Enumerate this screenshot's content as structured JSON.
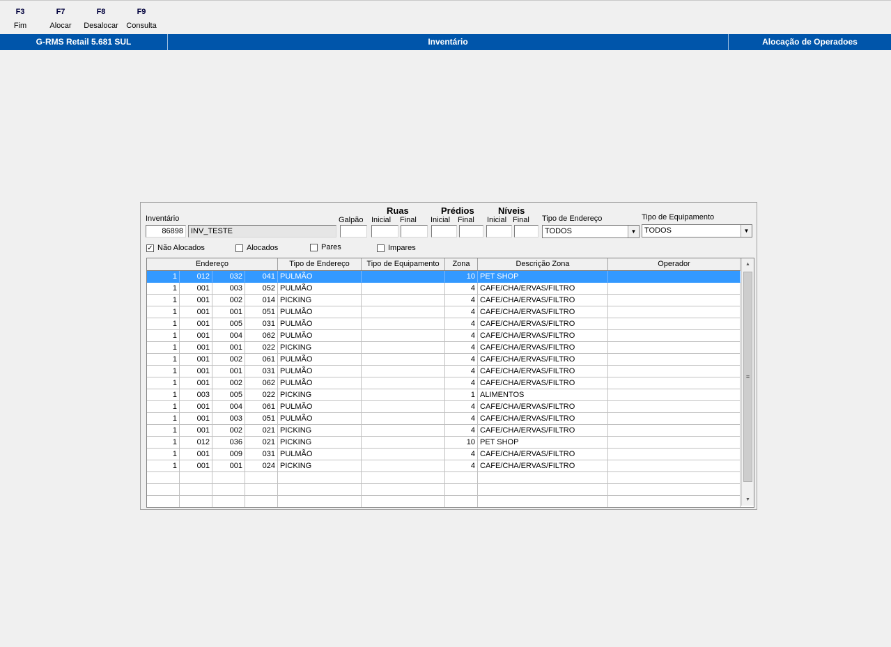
{
  "fkeys": [
    {
      "key": "F3",
      "label": "Fim"
    },
    {
      "key": "F7",
      "label": "Alocar"
    },
    {
      "key": "F8",
      "label": "Desalocar"
    },
    {
      "key": "F9",
      "label": "Consulta"
    }
  ],
  "titlebar": {
    "app": "G-RMS Retail 5.681 SUL",
    "module": "Inventário",
    "screen": "Alocação de Operadoes"
  },
  "filters": {
    "inventario_label": "Inventário",
    "inventario_code": "86898",
    "inventario_name": "INV_TESTE",
    "galpao_label": "Galpão",
    "ruas_label": "Ruas",
    "predios_label": "Prédios",
    "niveis_label": "Níveis",
    "inicial_label": "Inicial",
    "final_label": "Final",
    "tipo_endereco_label": "Tipo de Endereço",
    "tipo_endereco_value": "TODOS",
    "tipo_equipamento_label": "Tipo de Equipamento",
    "tipo_equipamento_value": "TODOS",
    "nao_alocados_label": "Não Alocados",
    "nao_alocados_checked": true,
    "alocados_label": "Alocados",
    "alocados_checked": false,
    "pares_label": "Pares",
    "pares_checked": false,
    "impares_label": "Impares",
    "impares_checked": false
  },
  "grid": {
    "columns": [
      "Endereço",
      "Tipo de Endereço",
      "Tipo de Equipamento",
      "Zona",
      "Descrição Zona",
      "Operador"
    ],
    "rows": [
      [
        "1",
        "012",
        "032",
        "041",
        "PULMÃO",
        "",
        "10",
        "PET SHOP",
        ""
      ],
      [
        "1",
        "001",
        "003",
        "052",
        "PULMÃO",
        "",
        "4",
        "CAFE/CHA/ERVAS/FILTRO",
        ""
      ],
      [
        "1",
        "001",
        "002",
        "014",
        "PICKING",
        "",
        "4",
        "CAFE/CHA/ERVAS/FILTRO",
        ""
      ],
      [
        "1",
        "001",
        "001",
        "051",
        "PULMÃO",
        "",
        "4",
        "CAFE/CHA/ERVAS/FILTRO",
        ""
      ],
      [
        "1",
        "001",
        "005",
        "031",
        "PULMÃO",
        "",
        "4",
        "CAFE/CHA/ERVAS/FILTRO",
        ""
      ],
      [
        "1",
        "001",
        "004",
        "062",
        "PULMÃO",
        "",
        "4",
        "CAFE/CHA/ERVAS/FILTRO",
        ""
      ],
      [
        "1",
        "001",
        "001",
        "022",
        "PICKING",
        "",
        "4",
        "CAFE/CHA/ERVAS/FILTRO",
        ""
      ],
      [
        "1",
        "001",
        "002",
        "061",
        "PULMÃO",
        "",
        "4",
        "CAFE/CHA/ERVAS/FILTRO",
        ""
      ],
      [
        "1",
        "001",
        "001",
        "031",
        "PULMÃO",
        "",
        "4",
        "CAFE/CHA/ERVAS/FILTRO",
        ""
      ],
      [
        "1",
        "001",
        "002",
        "062",
        "PULMÃO",
        "",
        "4",
        "CAFE/CHA/ERVAS/FILTRO",
        ""
      ],
      [
        "1",
        "003",
        "005",
        "022",
        "PICKING",
        "",
        "1",
        "ALIMENTOS",
        ""
      ],
      [
        "1",
        "001",
        "004",
        "061",
        "PULMÃO",
        "",
        "4",
        "CAFE/CHA/ERVAS/FILTRO",
        ""
      ],
      [
        "1",
        "001",
        "003",
        "051",
        "PULMÃO",
        "",
        "4",
        "CAFE/CHA/ERVAS/FILTRO",
        ""
      ],
      [
        "1",
        "001",
        "002",
        "021",
        "PICKING",
        "",
        "4",
        "CAFE/CHA/ERVAS/FILTRO",
        ""
      ],
      [
        "1",
        "012",
        "036",
        "021",
        "PICKING",
        "",
        "10",
        "PET SHOP",
        ""
      ],
      [
        "1",
        "001",
        "009",
        "031",
        "PULMÃO",
        "",
        "4",
        "CAFE/CHA/ERVAS/FILTRO",
        ""
      ],
      [
        "1",
        "001",
        "001",
        "024",
        "PICKING",
        "",
        "4",
        "CAFE/CHA/ERVAS/FILTRO",
        ""
      ]
    ],
    "empty_rows": 3,
    "selected_row": 0
  },
  "colors": {
    "titlebar": "#0055aa",
    "selection": "#3399ff"
  },
  "icons": {
    "check": "check-icon",
    "dropdown": "chevron-down-icon",
    "scroll_up": "arrow-up-icon",
    "scroll_down": "arrow-down-icon"
  }
}
